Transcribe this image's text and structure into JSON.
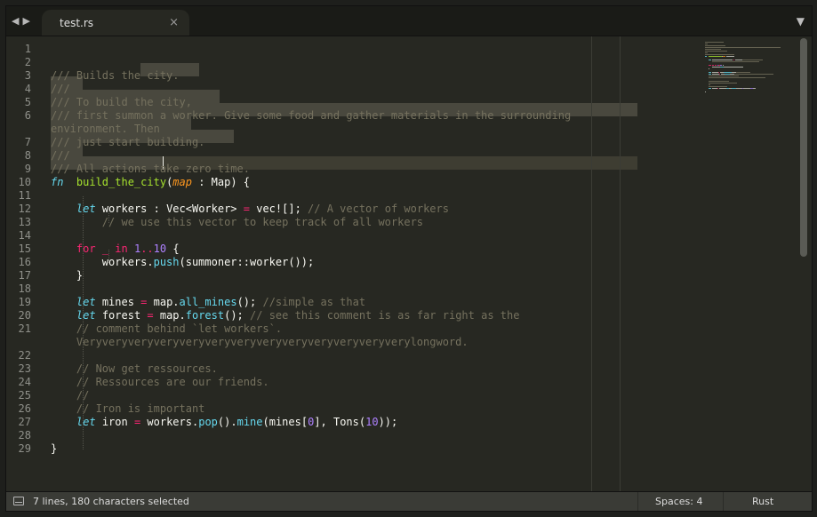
{
  "tab": {
    "title": "test.rs",
    "close_glyph": "×"
  },
  "nav": {
    "back": "◀",
    "forward": "▶",
    "menu": "▼"
  },
  "gutter": [
    {
      "n": "1",
      "row": 0
    },
    {
      "n": "2",
      "row": 1
    },
    {
      "n": "3",
      "row": 2
    },
    {
      "n": "4",
      "row": 3
    },
    {
      "n": "5",
      "row": 4
    },
    {
      "n": "6",
      "row": 5
    },
    {
      "n": "7",
      "row": 7
    },
    {
      "n": "8",
      "row": 8
    },
    {
      "n": "9",
      "row": 9
    },
    {
      "n": "10",
      "row": 10
    },
    {
      "n": "11",
      "row": 11
    },
    {
      "n": "12",
      "row": 12
    },
    {
      "n": "13",
      "row": 13
    },
    {
      "n": "14",
      "row": 14
    },
    {
      "n": "15",
      "row": 15
    },
    {
      "n": "16",
      "row": 16
    },
    {
      "n": "17",
      "row": 17
    },
    {
      "n": "18",
      "row": 18
    },
    {
      "n": "19",
      "row": 19
    },
    {
      "n": "20",
      "row": 20
    },
    {
      "n": "21",
      "row": 21
    },
    {
      "n": "22",
      "row": 23
    },
    {
      "n": "23",
      "row": 24
    },
    {
      "n": "24",
      "row": 25
    },
    {
      "n": "25",
      "row": 26
    },
    {
      "n": "26",
      "row": 27
    },
    {
      "n": "27",
      "row": 28
    },
    {
      "n": "28",
      "row": 29
    },
    {
      "n": "29",
      "row": 30
    }
  ],
  "code_lines": [
    {
      "row": 2,
      "tokens": [
        [
          "c-com",
          "/// Builds the city."
        ]
      ]
    },
    {
      "row": 3,
      "tokens": [
        [
          "c-com",
          "///"
        ]
      ]
    },
    {
      "row": 4,
      "tokens": [
        [
          "c-com",
          "/// To build the city,"
        ]
      ]
    },
    {
      "row": 5,
      "tokens": [
        [
          "c-com",
          "/// first summon a worker. Give some food and gather materials in the surrounding"
        ]
      ]
    },
    {
      "row": 6,
      "tokens": [
        [
          "c-com",
          "environment. Then"
        ]
      ]
    },
    {
      "row": 7,
      "tokens": [
        [
          "c-com",
          "/// just start building."
        ]
      ]
    },
    {
      "row": 8,
      "tokens": [
        [
          "c-com",
          "///"
        ]
      ]
    },
    {
      "row": 9,
      "tokens": [
        [
          "c-com",
          "/// All actions take zero time."
        ]
      ]
    },
    {
      "row": 10,
      "tokens": [
        [
          "c-st",
          "fn"
        ],
        [
          "",
          "  "
        ],
        [
          "c-fn",
          "build_the_city"
        ],
        [
          "",
          "("
        ],
        [
          "c-arg",
          "map"
        ],
        [
          "",
          " : Map) {"
        ]
      ]
    },
    {
      "row": 12,
      "tokens": [
        [
          "",
          "    "
        ],
        [
          "c-st",
          "let"
        ],
        [
          "",
          " workers : Vec<Worker> "
        ],
        [
          "c-op",
          "="
        ],
        [
          "",
          " vec![]; "
        ],
        [
          "c-com",
          "// A vector of workers"
        ]
      ]
    },
    {
      "row": 13,
      "tokens": [
        [
          "c-com",
          "        // we use this vector to keep track of all workers"
        ]
      ]
    },
    {
      "row": 15,
      "tokens": [
        [
          "",
          "    "
        ],
        [
          "c-kw",
          "for"
        ],
        [
          "c-kw",
          " _ "
        ],
        [
          "c-kw",
          "in"
        ],
        [
          "",
          " "
        ],
        [
          "c-num",
          "1"
        ],
        [
          "c-op",
          ".."
        ],
        [
          "c-num",
          "10"
        ],
        [
          "",
          " {"
        ]
      ]
    },
    {
      "row": 16,
      "tokens": [
        [
          "",
          "        workers."
        ],
        [
          "c-sup",
          "push"
        ],
        [
          "",
          "(summoner::worker());"
        ]
      ]
    },
    {
      "row": 17,
      "tokens": [
        [
          "",
          "    }"
        ]
      ]
    },
    {
      "row": 19,
      "tokens": [
        [
          "",
          "    "
        ],
        [
          "c-st",
          "let"
        ],
        [
          "",
          " mines "
        ],
        [
          "c-op",
          "="
        ],
        [
          "",
          " map."
        ],
        [
          "c-sup",
          "all_mines"
        ],
        [
          "",
          "(); "
        ],
        [
          "c-com",
          "//simple as that"
        ]
      ]
    },
    {
      "row": 20,
      "tokens": [
        [
          "",
          "    "
        ],
        [
          "c-st",
          "let"
        ],
        [
          "",
          " forest "
        ],
        [
          "c-op",
          "="
        ],
        [
          "",
          " map."
        ],
        [
          "c-sup",
          "forest"
        ],
        [
          "",
          "(); "
        ],
        [
          "c-com",
          "// see this comment is as far right as the"
        ]
      ]
    },
    {
      "row": 21,
      "tokens": [
        [
          "c-com",
          "    // comment behind `let workers`."
        ]
      ]
    },
    {
      "row": 22,
      "tokens": [
        [
          "c-com",
          "    Veryveryveryveryveryveryveryveryveryveryveryveryverylongword."
        ]
      ]
    },
    {
      "row": 24,
      "tokens": [
        [
          "c-com",
          "    // Now get ressources."
        ]
      ]
    },
    {
      "row": 25,
      "tokens": [
        [
          "c-com",
          "    // Ressources are our friends."
        ]
      ]
    },
    {
      "row": 26,
      "tokens": [
        [
          "c-com",
          "    //"
        ]
      ]
    },
    {
      "row": 27,
      "tokens": [
        [
          "c-com",
          "    // Iron is important"
        ]
      ]
    },
    {
      "row": 28,
      "tokens": [
        [
          "",
          "    "
        ],
        [
          "c-st",
          "let"
        ],
        [
          "",
          " iron "
        ],
        [
          "c-op",
          "="
        ],
        [
          "",
          " workers."
        ],
        [
          "c-sup",
          "pop"
        ],
        [
          "",
          "()."
        ],
        [
          "c-sup",
          "mine"
        ],
        [
          "",
          "(mines["
        ],
        [
          "c-num",
          "0"
        ],
        [
          "",
          "], Tons("
        ],
        [
          "c-num",
          "10"
        ],
        [
          "",
          "));"
        ]
      ]
    },
    {
      "row": 30,
      "tokens": [
        [
          "",
          "}"
        ]
      ]
    }
  ],
  "status": {
    "selection": "7 lines, 180 characters selected",
    "indentation": "Spaces: 4",
    "syntax": "Rust"
  },
  "colors": {
    "background": "#272822",
    "comment": "#75715e",
    "keyword": "#f92672",
    "storage": "#66d9ef",
    "function": "#a6e22e",
    "parameter": "#fd971f",
    "number": "#ae81ff",
    "selection": "#49483e"
  }
}
